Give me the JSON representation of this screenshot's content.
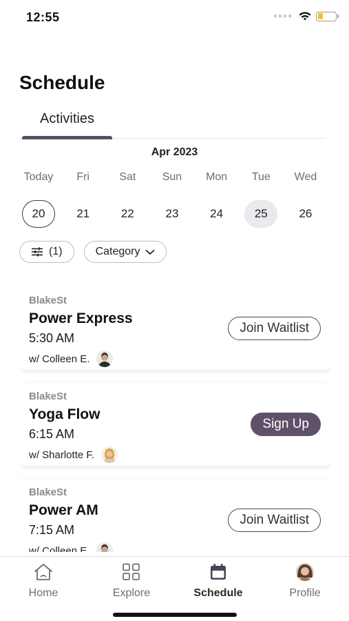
{
  "status_bar": {
    "time": "12:55"
  },
  "header": {
    "title": "Schedule"
  },
  "tabs": [
    {
      "label": "Activities",
      "active": true
    }
  ],
  "calendar": {
    "month": "Apr 2023",
    "days": [
      {
        "weekday": "Today",
        "date": "20",
        "today": true,
        "selected": false
      },
      {
        "weekday": "Fri",
        "date": "21",
        "today": false,
        "selected": false
      },
      {
        "weekday": "Sat",
        "date": "22",
        "today": false,
        "selected": false
      },
      {
        "weekday": "Sun",
        "date": "23",
        "today": false,
        "selected": false
      },
      {
        "weekday": "Mon",
        "date": "24",
        "today": false,
        "selected": false
      },
      {
        "weekday": "Tue",
        "date": "25",
        "today": false,
        "selected": true
      },
      {
        "weekday": "Wed",
        "date": "26",
        "today": false,
        "selected": false
      }
    ]
  },
  "filters": {
    "filter_chip": {
      "icon": "sliders-icon",
      "label": "(1)"
    },
    "category_chip": {
      "label": "Category",
      "icon": "chevron-down-icon"
    }
  },
  "classes": [
    {
      "location": "BlakeSt",
      "title": "Power Express",
      "time": "5:30 AM",
      "instructor": "w/ Colleen E.",
      "action": "Join Waitlist",
      "action_style": "outline"
    },
    {
      "location": "BlakeSt",
      "title": "Yoga Flow",
      "time": "6:15 AM",
      "instructor": "w/ Sharlotte F.",
      "action": "Sign Up",
      "action_style": "filled"
    },
    {
      "location": "BlakeSt",
      "title": "Power AM",
      "time": "7:15 AM",
      "instructor": "w/ Colleen E.",
      "action": "Join Waitlist",
      "action_style": "outline"
    }
  ],
  "tab_bar": {
    "items": [
      {
        "label": "Home",
        "icon": "home-icon",
        "active": false
      },
      {
        "label": "Explore",
        "icon": "grid-icon",
        "active": false
      },
      {
        "label": "Schedule",
        "icon": "calendar-icon",
        "active": true
      },
      {
        "label": "Profile",
        "icon": "profile-avatar",
        "active": false
      }
    ]
  },
  "colors": {
    "accent": "#5e5169",
    "selected_date_bg": "#e9e9ee",
    "battery": "#f5c518"
  }
}
